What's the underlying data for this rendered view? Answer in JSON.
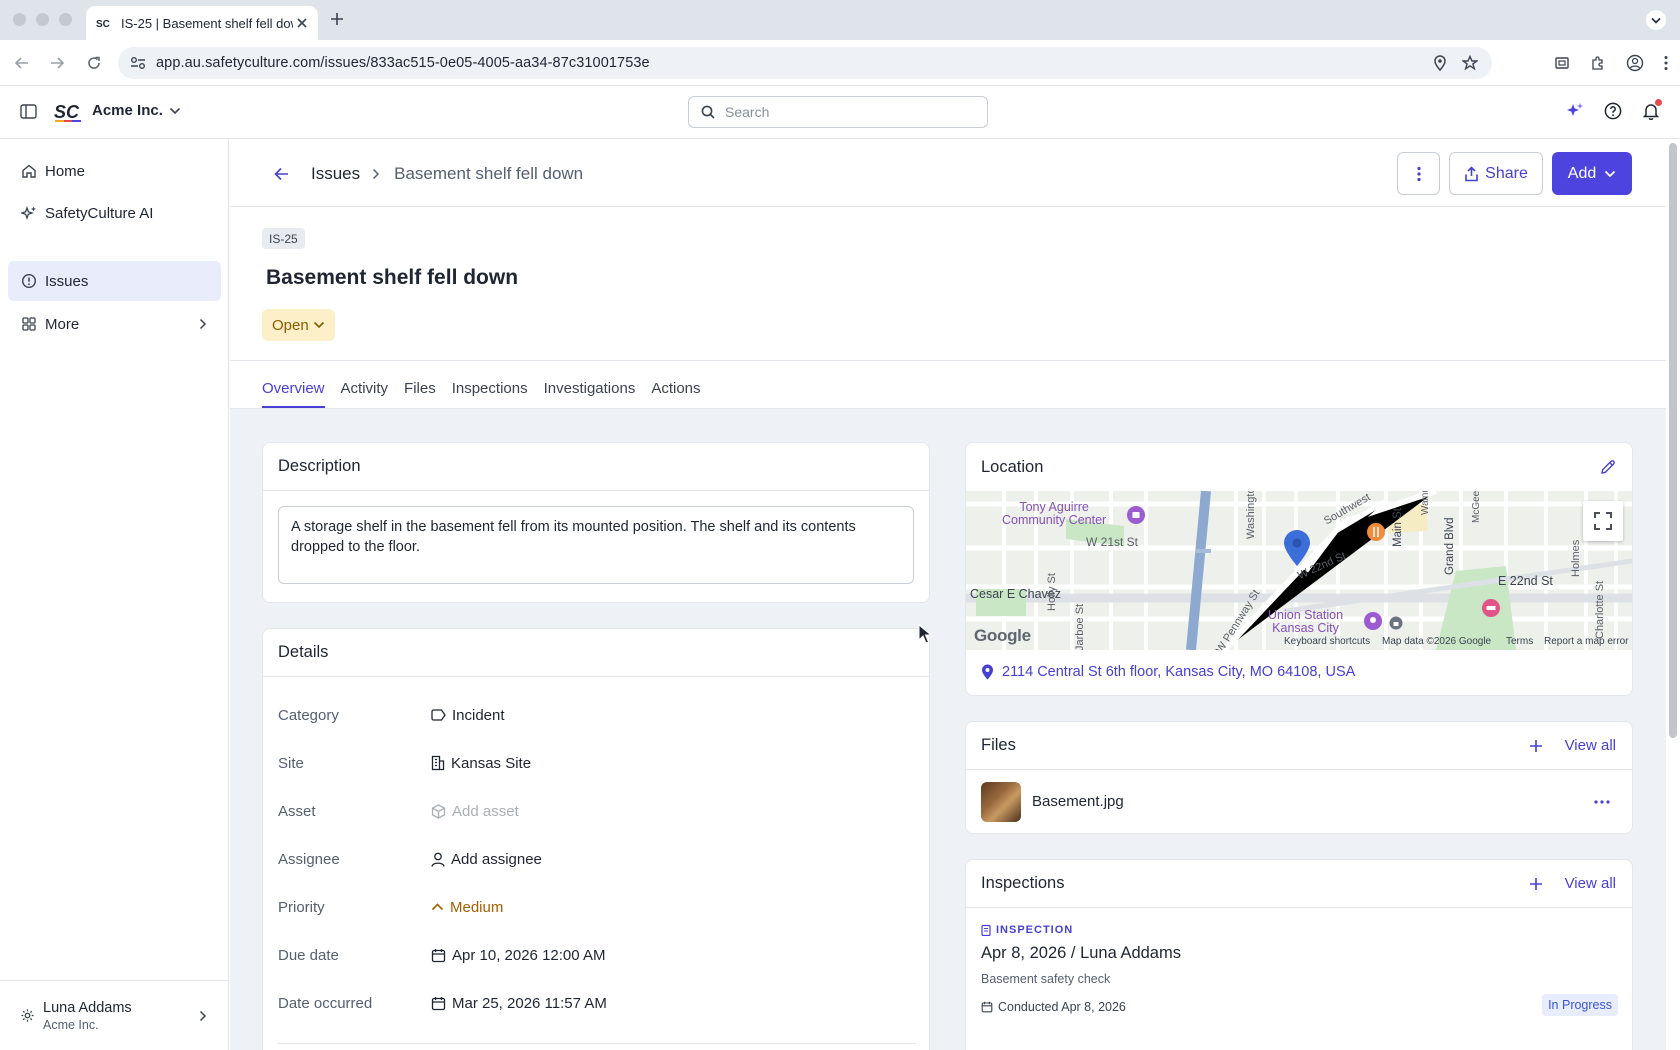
{
  "browser": {
    "tab_title": "IS-25 | Basement shelf fell down",
    "url": "app.au.safetyculture.com/issues/833ac515-0e05-4005-aa34-87c31001753e"
  },
  "app": {
    "logo_text": "SC",
    "org_name": "Acme Inc.",
    "search_placeholder": "Search"
  },
  "sidebar": {
    "items": [
      {
        "label": "Home",
        "icon": "home-icon"
      },
      {
        "label": "SafetyCulture AI",
        "icon": "sparkle-icon"
      },
      {
        "label": "Issues",
        "icon": "issue-icon",
        "active": true
      },
      {
        "label": "More",
        "icon": "grid-icon"
      }
    ],
    "user": {
      "name": "Luna Addams",
      "org": "Acme Inc."
    }
  },
  "header": {
    "breadcrumb_parent": "Issues",
    "breadcrumb_current": "Basement shelf fell down",
    "share_label": "Share",
    "add_label": "Add"
  },
  "issue": {
    "id": "IS-25",
    "title": "Basement shelf fell down",
    "status": "Open"
  },
  "tabs": [
    "Overview",
    "Activity",
    "Files",
    "Inspections",
    "Investigations",
    "Actions"
  ],
  "description": {
    "heading": "Description",
    "text": "A storage shelf in the basement fell from its mounted position. The shelf and its contents dropped to the floor."
  },
  "details": {
    "heading": "Details",
    "rows": [
      {
        "label": "Category",
        "value": "Incident"
      },
      {
        "label": "Site",
        "value": "Kansas Site"
      },
      {
        "label": "Asset",
        "value": "Add asset"
      },
      {
        "label": "Assignee",
        "value": "Add assignee"
      },
      {
        "label": "Priority",
        "value": "Medium"
      },
      {
        "label": "Due date",
        "value": "Apr 10, 2026 12:00 AM"
      },
      {
        "label": "Date occurred",
        "value": "Mar 25, 2026 11:57 AM"
      }
    ]
  },
  "location": {
    "heading": "Location",
    "address": "2114 Central St 6th floor, Kansas City, MO 64108, USA",
    "map": {
      "labels": [
        "Tony Aguirre",
        "Community Center",
        "W 21st St",
        "Cesar E Chavez",
        "Holly St",
        "Jarboe St",
        "Washington",
        "Southwest",
        "W 22nd St",
        "W Pennway St",
        "Union Station",
        "Kansas City",
        "Main St",
        "Grand Blvd",
        "McGee",
        "E 22nd St",
        "Holmes",
        "Charlotte St",
        "Walnut"
      ],
      "footer": [
        "Keyboard shortcuts",
        "Map data ©2026 Google",
        "Terms",
        "Report a map error"
      ],
      "brand": "Google"
    }
  },
  "files": {
    "heading": "Files",
    "view_all": "View all",
    "items": [
      {
        "name": "Basement.jpg"
      }
    ]
  },
  "inspections": {
    "heading": "Inspections",
    "view_all": "View all",
    "kicker": "INSPECTION",
    "title": "Apr 8, 2026 / Luna Addams",
    "subtitle": "Basement safety check",
    "conducted": "Conducted Apr 8, 2026",
    "status": "In Progress"
  }
}
